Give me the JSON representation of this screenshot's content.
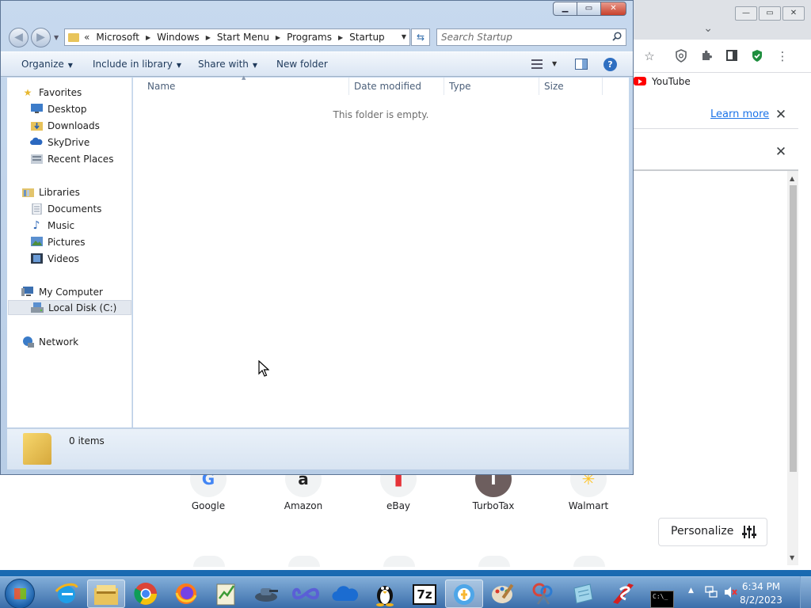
{
  "chrome": {
    "win_min": "—",
    "win_max": "▭",
    "win_close": "✕",
    "tab_dropdown": "⌄",
    "toolbar_icons": [
      "star-icon",
      "shield-extension-icon",
      "puzzle-icon",
      "sidepanel-icon",
      "green-shield-icon",
      "kebab-menu-icon"
    ],
    "bookmark_youtube": "YouTube",
    "learn_more": "Learn more",
    "close_glyph": "✕",
    "shortcuts": [
      {
        "label": "Google",
        "glyph": "G",
        "color": "#4285f4"
      },
      {
        "label": "Amazon",
        "glyph": "a",
        "color": "#222222"
      },
      {
        "label": "eBay",
        "glyph": "▮",
        "color": "#e53238"
      },
      {
        "label": "TurboTax",
        "glyph": "T",
        "color": "#ffffff"
      },
      {
        "label": "Walmart",
        "glyph": "✳",
        "color": "#ffc220"
      }
    ],
    "personalize": "Personalize"
  },
  "explorer": {
    "breadcrumb": [
      "Microsoft",
      "Windows",
      "Start Menu",
      "Programs",
      "Startup"
    ],
    "breadcrumb_overflow": "«",
    "search_placeholder": "Search Startup",
    "commands": {
      "organize": "Organize",
      "include_in_library": "Include in library",
      "share_with": "Share with",
      "new_folder": "New folder"
    },
    "nav": {
      "favorites": "Favorites",
      "desktop": "Desktop",
      "downloads": "Downloads",
      "skydrive": "SkyDrive",
      "recent_places": "Recent Places",
      "libraries": "Libraries",
      "documents": "Documents",
      "music": "Music",
      "pictures": "Pictures",
      "videos": "Videos",
      "my_computer": "My Computer",
      "local_disk": "Local Disk (C:)",
      "network": "Network"
    },
    "columns": [
      "Name",
      "Date modified",
      "Type",
      "Size"
    ],
    "empty_message": "This folder is empty.",
    "item_count": "0 items",
    "help_glyph": "?"
  },
  "taskbar": {
    "time": "6:34 PM",
    "date": "8/2/2023",
    "apps": [
      "internet-explorer",
      "file-explorer",
      "chrome",
      "firefox",
      "notepad-plus",
      "tank-game",
      "infinity-app",
      "onedrive",
      "linux-penguin",
      "7zip",
      "secure-browser",
      "paint",
      "scissors-tool",
      "notes-app",
      "red-s-app",
      "command-prompt"
    ],
    "label_7z": "7z",
    "label_cmd": "C:\\_"
  },
  "colors": {
    "accent_blue": "#1a73e8",
    "explorer_frame": "#c7d9ee",
    "close_red": "#c8412c"
  }
}
